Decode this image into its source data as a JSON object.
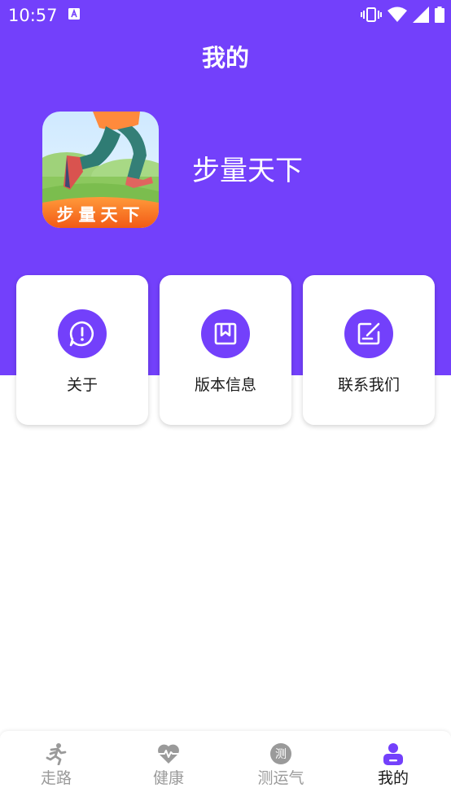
{
  "status_bar": {
    "time": "10:57",
    "icons": [
      "keyboard-a-icon",
      "vibrate-icon",
      "wifi-icon",
      "signal-icon",
      "battery-icon"
    ]
  },
  "header": {
    "title": "我的"
  },
  "profile": {
    "logo_text": "步量天下",
    "app_name": "步量天下"
  },
  "cards": [
    {
      "label": "关于",
      "icon": "info-icon"
    },
    {
      "label": "版本信息",
      "icon": "bookmark-icon"
    },
    {
      "label": "联系我们",
      "icon": "edit-icon"
    }
  ],
  "tab_bar": {
    "tabs": [
      {
        "label": "走路",
        "icon": "running-icon",
        "active": false
      },
      {
        "label": "健康",
        "icon": "heart-pulse-icon",
        "active": false
      },
      {
        "label": "测运气",
        "icon": "fortune-icon",
        "icon_text": "测",
        "active": false
      },
      {
        "label": "我的",
        "icon": "user-icon",
        "active": true
      }
    ]
  },
  "colors": {
    "primary": "#7340fb",
    "tab_inactive": "#9a9a9a",
    "tab_active": "#1a1a1a"
  }
}
